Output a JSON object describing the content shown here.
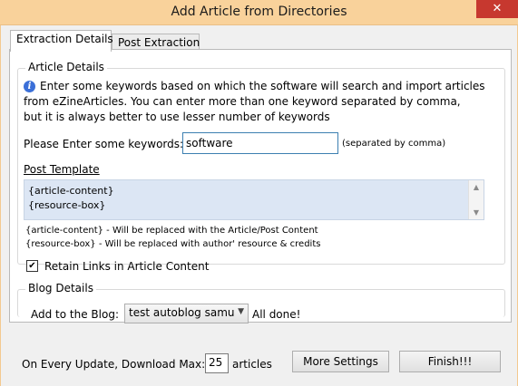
{
  "window": {
    "title": "Add Article from Directories",
    "close_glyph": "✕"
  },
  "tabs": [
    {
      "label": "Extraction Details",
      "active": true
    },
    {
      "label": "Post Extraction",
      "active": false
    }
  ],
  "article_details": {
    "legend": "Article Details",
    "info_icon": "info-icon",
    "description_lines": [
      "Enter some keywords based on which the software will search and import articles",
      "from eZineArticles. You can enter more than one keyword separated by comma,",
      "but it is always better to use lesser number of keywords"
    ],
    "keywords_label": "Please Enter some keywords:",
    "keywords_value": "software",
    "keywords_hint": "(separated by comma)",
    "post_template_label": "Post Template",
    "template_lines": [
      "{article-content}",
      "{resource-box}"
    ],
    "placeholder_help": [
      "{article-content} - Will be replaced with the Article/Post Content",
      "{resource-box} - Will be replaced with author' resource & credits"
    ],
    "retain_links_label": "Retain Links in Article Content",
    "retain_links_checked": true
  },
  "blog_details": {
    "legend": "Blog Details",
    "add_to_blog_label": "Add to the Blog:",
    "selected_blog": "test autoblog samu",
    "status": "All done!"
  },
  "footer": {
    "download_max_label": "On Every Update, Download Max:",
    "download_max_value": "25",
    "download_max_unit": "articles",
    "more_settings_label": "More Settings",
    "finish_label": "Finish!!!"
  },
  "colors": {
    "titlebar": "#f9d29b",
    "close_button": "#c7382f",
    "template_box": "#dce6f4",
    "info_icon": "#3a6fd8"
  }
}
